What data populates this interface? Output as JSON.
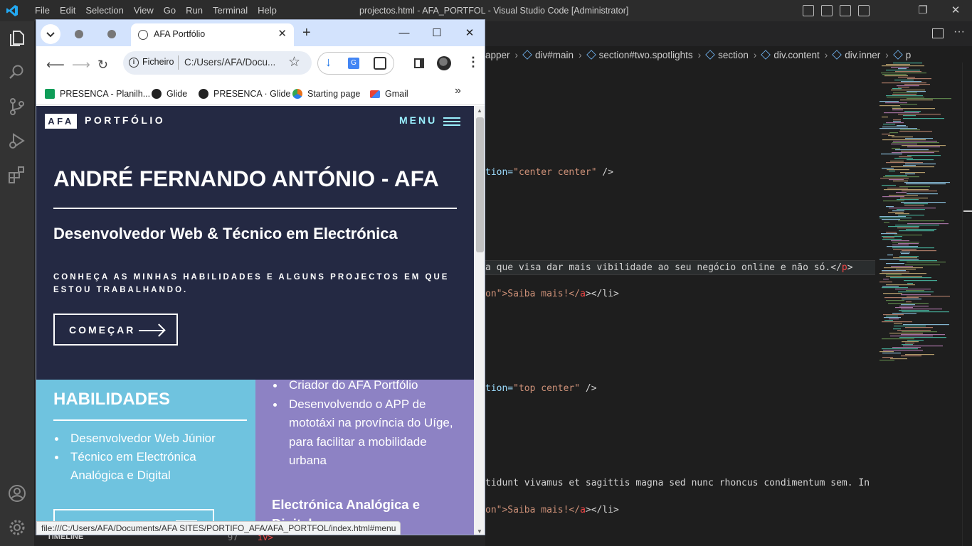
{
  "vscode": {
    "menu": [
      "File",
      "Edit",
      "Selection",
      "View",
      "Go",
      "Run",
      "Terminal",
      "Help"
    ],
    "window_title": "projectos.html - AFA_PORTFOL - Visual Studio Code [Administrator]",
    "breadcrumb": [
      "apper",
      "div#main",
      "section#two.spotlights",
      "section",
      "div.content",
      "div.inner",
      "p"
    ],
    "code_lines": [
      {
        "pre": "tion=",
        "str": "\"center center\"",
        "post": " />",
        "row": 0
      },
      {
        "pre": "a que visa dar mais vibilidade ao seu negócio online e não só.</",
        "tag": "p",
        "post": ">",
        "row": 1
      },
      {
        "pre": "on\">Saiba mais!</",
        "tag": "a",
        "post": "></li>",
        "row": 2
      },
      {
        "pre": "tion=",
        "str": "\"top center\"",
        "post": " />",
        "row": 3
      },
      {
        "pre": "tidunt vivamus et sagittis magna sed nunc rhoncus condimentum sem. In ef",
        "row": 4
      },
      {
        "pre": "on\">Saiba mais!</",
        "tag": "a",
        "post": "></li>",
        "row": 5
      }
    ],
    "timeline_label": "TIMELINE",
    "line_number": "97",
    "line_code": "iv>",
    "accent": "#007acc"
  },
  "chrome": {
    "tab_title": "AFA Portfólio",
    "omnibox_scheme": "Ficheiro",
    "omnibox_url": "C:/Users/AFA/Docu...",
    "bookmarks": [
      {
        "label": "PRESENCA - Planilh...",
        "icon": "sheets-icon",
        "color": "#0f9d58"
      },
      {
        "label": "Glide",
        "icon": "glide-icon",
        "color": "#222"
      },
      {
        "label": "PRESENCA · Glide",
        "icon": "glide-icon",
        "color": "#222"
      },
      {
        "label": "Starting page",
        "icon": "startpage-icon",
        "color": "#e8711a"
      },
      {
        "label": "Gmail",
        "icon": "gmail-icon",
        "color": "#ea4335"
      }
    ],
    "status_url": "file:///C:/Users/AFA/Documents/AFA SITES/PORTIFO_AFA/AFA_PORTFOL/index.html#menu"
  },
  "site": {
    "logo_box": "AFA",
    "logo_text": "PORTFÓLIO",
    "menu_label": "MENU",
    "hero_title": "ANDRÉ FERNANDO ANTÓNIO - AFA",
    "hero_subtitle": "Desenvolvedor Web & Técnico em Electrónica",
    "hero_text": "CONHEÇA AS MINHAS HABILIDADES E ALGUNS PROJECTOS EM QUE ESTOU TRABALHANDO.",
    "start_button": "COMEÇAR",
    "skills_heading": "HABILIDADES",
    "skills": [
      "Desenvolvedor Web Júnior",
      "Técnico em Electrónica Analógica e Digital"
    ],
    "projects": [
      "Criador do AFA Portfólio",
      "Desenvolvendo o APP de mototáxi na província do Uíge, para facilitar a mobilidade urbana"
    ],
    "projects_heading": "Electrónica Analógica e Digital",
    "colors": {
      "hero": "#242943",
      "skills": "#6fc3df",
      "projects": "#8d82c4",
      "menu": "#9bf1ff"
    }
  }
}
